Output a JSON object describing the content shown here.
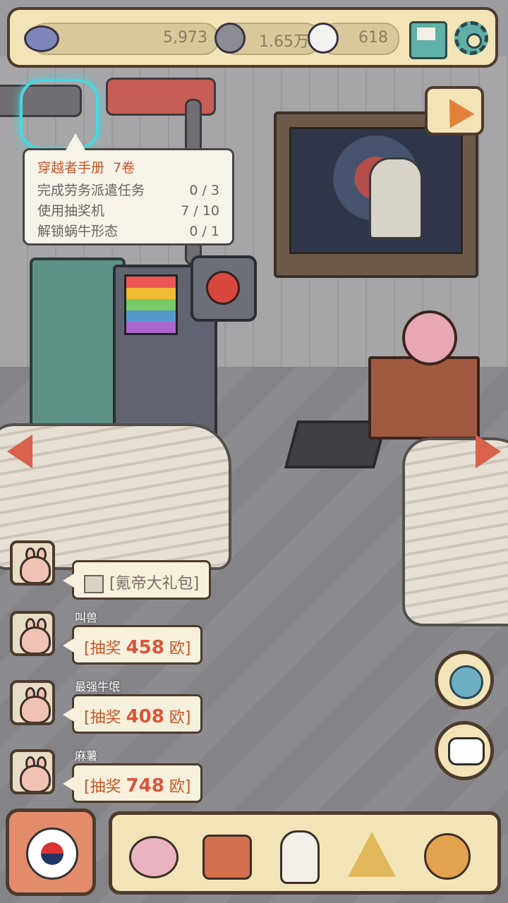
{
  "currency": {
    "primary": "5,973",
    "secondary": "1.65万",
    "tertiary": "618"
  },
  "tooltip": {
    "title": "穿越者手册",
    "volume": "7卷",
    "tasks": [
      {
        "label": "完成劳务派遣任务",
        "progress": "0 / 3"
      },
      {
        "label": "使用抽奖机",
        "progress": "7 / 10"
      },
      {
        "label": "解锁蜗牛形态",
        "progress": "0 / 1"
      }
    ]
  },
  "feed": [
    {
      "user": "",
      "message": "[氪帝大礼包]"
    },
    {
      "user": "叫兽",
      "prefix": "[抽奖 ",
      "amount": "458",
      "suffix": " 欧]"
    },
    {
      "user": "最强牛氓",
      "prefix": "[抽奖 ",
      "amount": "408",
      "suffix": " 欧]"
    },
    {
      "user": "麻薯",
      "prefix": "[抽奖 ",
      "amount": "748",
      "suffix": " 欧]"
    }
  ],
  "icons": {
    "primary_currency": "blue-coin-icon",
    "secondary_currency": "speech-bubble-icon",
    "tertiary_currency": "ghost-icon",
    "mail": "mail-icon",
    "settings": "gear-icon",
    "party": "party-popper-icon",
    "planet": "planet-icon",
    "chat": "chat-icon",
    "home": "korea-flag-icon",
    "nav": [
      "snail-icon",
      "suitcase-icon",
      "bust-icon",
      "pyramid-eye-icon",
      "key-icon"
    ]
  },
  "colors": {
    "panel": "#f3e4b8",
    "border": "#4d3b2c",
    "accent": "#c6572a"
  }
}
